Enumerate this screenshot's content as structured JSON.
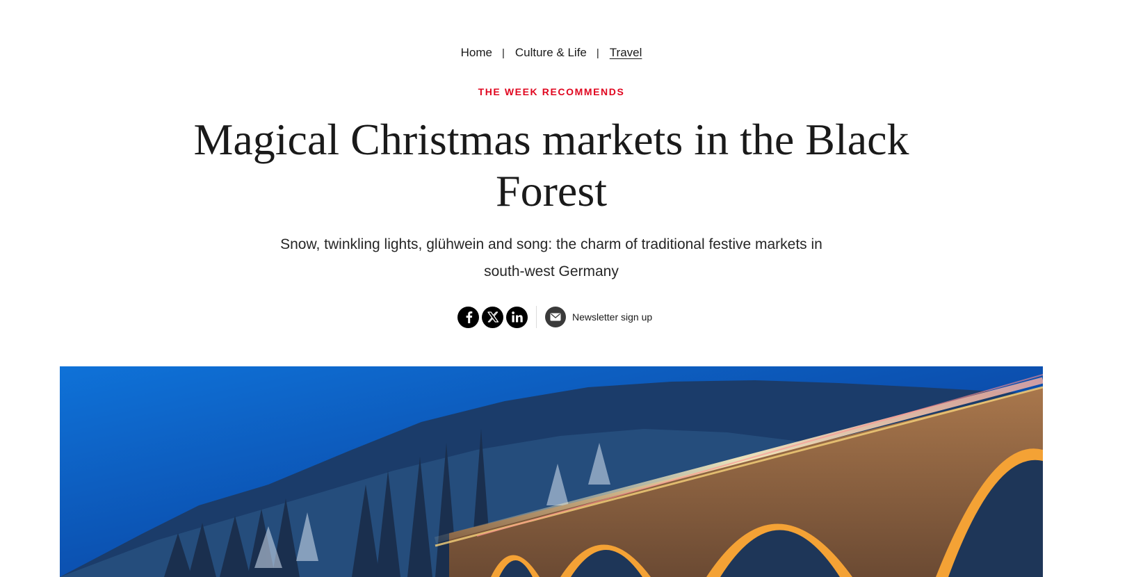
{
  "breadcrumb": {
    "items": [
      {
        "label": "Home"
      },
      {
        "label": "Culture & Life"
      },
      {
        "label": "Travel"
      }
    ],
    "separator": "|"
  },
  "article": {
    "kicker": "THE WEEK RECOMMENDS",
    "headline": "Magical Christmas markets in the Black Forest",
    "standfirst": "Snow, twinkling lights, glühwein and song: the charm of traditional festive markets in south-west Germany"
  },
  "share": {
    "icons": [
      "facebook-icon",
      "x-icon",
      "linkedin-icon"
    ],
    "newsletter_label": "Newsletter sign up",
    "newsletter_icon": "envelope-icon"
  },
  "colors": {
    "kicker": "#e0061f",
    "text": "#1a1a1a",
    "sky_top": "#0a3f8f",
    "sky_bottom": "#0f72d8",
    "bridge_lights": "#f4a235"
  }
}
